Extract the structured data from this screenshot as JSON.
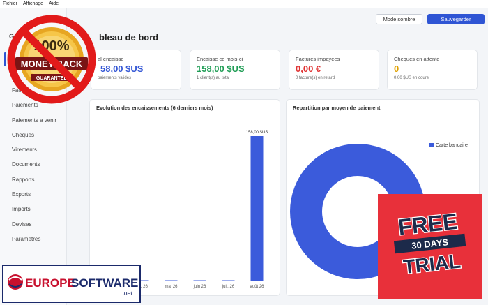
{
  "menu": [
    "Fichier",
    "Affichage",
    "Aide"
  ],
  "sidebar": {
    "title": "Ge",
    "items": [
      "Factu",
      "Paiements",
      "Paiements a venir",
      "Cheques",
      "Virements",
      "Documents",
      "Rapports",
      "Exports",
      "Imports",
      "Devises",
      "Parametres"
    ]
  },
  "toolbar": {
    "dark_mode": "Mode sombre",
    "save": "Sauvegarder"
  },
  "page_title": "bleau de bord",
  "stats": [
    {
      "label": "al encaisse",
      "value": "58,00 $US",
      "sub": "paiements valides",
      "color": "#3457d5"
    },
    {
      "label": "Encaisse ce mois-ci",
      "value": "158,00 $US",
      "sub": "1 client(s) au total",
      "color": "#1f9d55"
    },
    {
      "label": "Factures impayees",
      "value": "0,00 €",
      "sub": "0 facture(s) en retard",
      "color": "#e03131"
    },
    {
      "label": "Cheques en attente",
      "value": "0",
      "sub": "0.00 $US en coure",
      "color": "#e0a100"
    }
  ],
  "charts": {
    "bar_title": "Evolution des encaissements (6 derniers mois)",
    "donut_title": "Repartition par moyen de paiement",
    "legend": "Carte bancaire"
  },
  "chart_data": [
    {
      "type": "bar",
      "title": "Evolution des encaissements (6 derniers mois)",
      "categories": [
        "",
        "vr. 26",
        "mai 26",
        "juin 26",
        "juil. 26",
        "août 26"
      ],
      "values": [
        0,
        0,
        0,
        0,
        0,
        158
      ],
      "data_labels": [
        "",
        "",
        "",
        "",
        "",
        "158,00 $US"
      ],
      "ylim": [
        0,
        158
      ],
      "color": "#3b5bdb"
    },
    {
      "type": "pie",
      "title": "Repartition par moyen de paiement",
      "labels": [
        "Carte bancaire"
      ],
      "values": [
        158
      ],
      "colors": [
        "#3b5bdb"
      ],
      "legend": "top-right"
    }
  ],
  "ads": {
    "money_back": {
      "top": "100%",
      "band": "MONEY BACK",
      "bottom": "GUARANTEE"
    },
    "trial": {
      "line1": "FREE",
      "line2": "30 DAYS",
      "line3": "TRIAL"
    },
    "logo": {
      "left": "EUROPE",
      "right": "SOFTWARES",
      "tld": ".net"
    }
  },
  "colors": {
    "accent": "#2f55d4",
    "bar": "#3b5bdb",
    "ad_red": "#e8303a"
  }
}
